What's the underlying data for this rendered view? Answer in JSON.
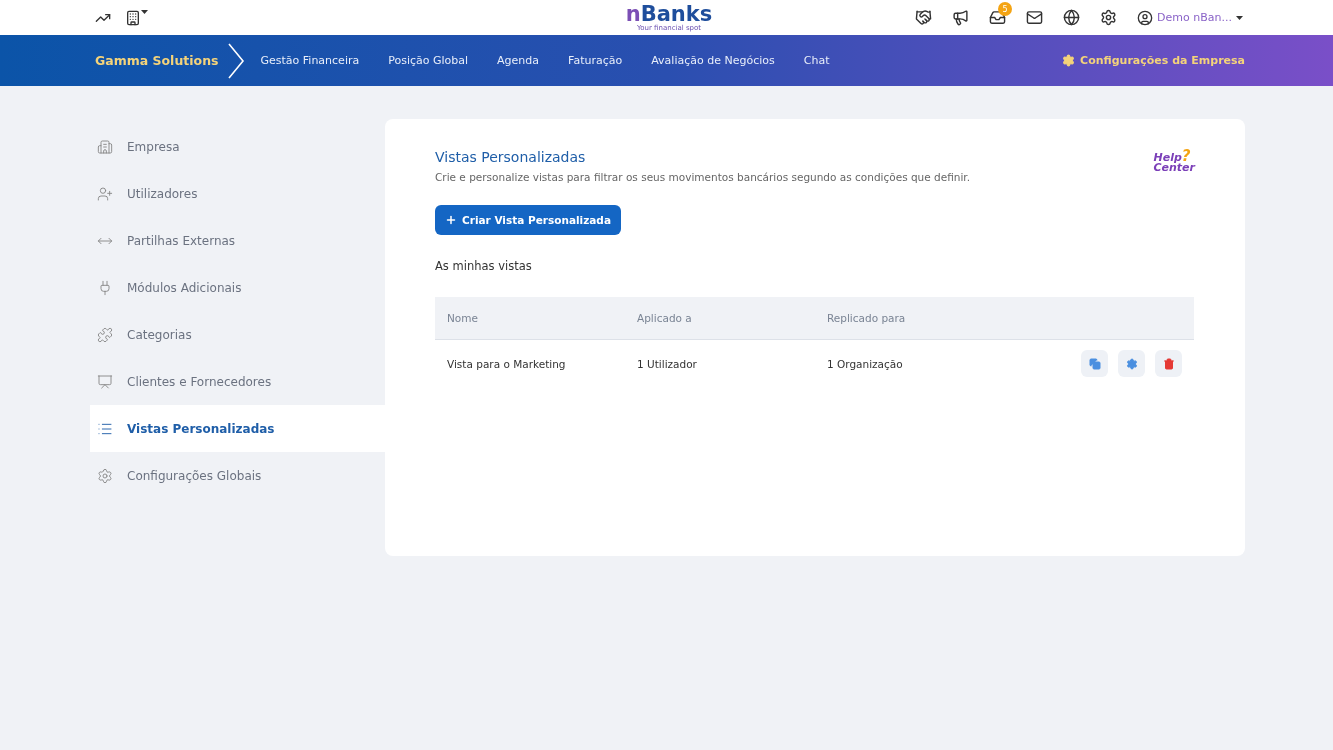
{
  "topbar": {
    "logo": {
      "first": "n",
      "rest": "Banks",
      "tagline": "Your financial spot"
    },
    "notification_count": "5",
    "user": "Demo nBan..."
  },
  "nav": {
    "company": "Gamma Solutions",
    "items": [
      "Gestão Financeira",
      "Posição Global",
      "Agenda",
      "Faturação",
      "Avaliação de Negócios",
      "Chat"
    ],
    "settings": "Configurações da Empresa"
  },
  "sidebar": {
    "items": [
      {
        "label": "Empresa",
        "selected": false
      },
      {
        "label": "Utilizadores",
        "selected": false
      },
      {
        "label": "Partilhas Externas",
        "selected": false
      },
      {
        "label": "Módulos Adicionais",
        "selected": false
      },
      {
        "label": "Categorias",
        "selected": false
      },
      {
        "label": "Clientes e Fornecedores",
        "selected": false
      },
      {
        "label": "Vistas Personalizadas",
        "selected": true
      },
      {
        "label": "Configurações Globais",
        "selected": false
      }
    ]
  },
  "main": {
    "title": "Vistas Personalizadas",
    "description": "Crie e personalize vistas para filtrar os seus movimentos bancários segundo as condições que definir.",
    "help": {
      "top": "Help",
      "mark": "?",
      "bottom": "Center"
    },
    "create_button": "Criar Vista Personalizada",
    "section_title": "As minhas vistas",
    "table": {
      "columns": [
        "Nome",
        "Aplicado a",
        "Replicado para"
      ],
      "rows": [
        {
          "cells": [
            "Vista para o Marketing",
            "1 Utilizador",
            "1 Organização"
          ]
        }
      ]
    }
  }
}
